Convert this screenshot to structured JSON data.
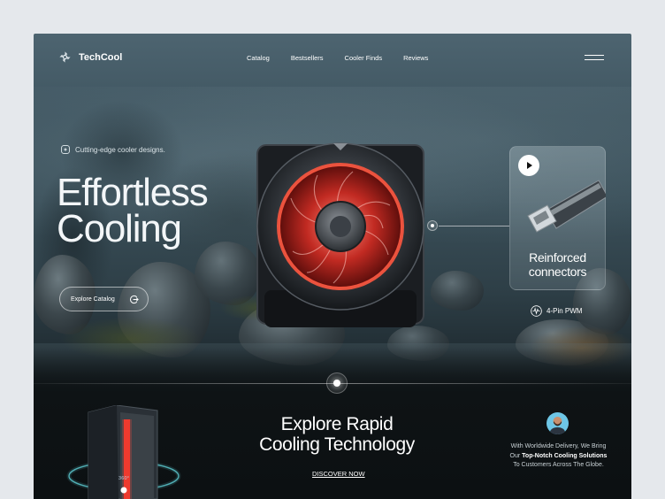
{
  "brand": {
    "name": "TechCool"
  },
  "nav": {
    "items": [
      "Catalog",
      "Bestsellers",
      "Cooler Finds",
      "Reviews"
    ]
  },
  "hero": {
    "tagline": "Cutting-edge cooler designs.",
    "title_line1": "Effortless",
    "title_line2": "Cooling",
    "cta_label": "Explore Catalog"
  },
  "feature_card": {
    "label_line1": "Reinforced",
    "label_line2": "connectors"
  },
  "spec": {
    "label": "4-Pin PWM"
  },
  "case_label": "360°",
  "section": {
    "title_line1": "Explore Rapid",
    "title_line2": "Cooling Technology",
    "link_label": "DISCOVER NOW"
  },
  "delivery": {
    "text1": "With Worldwide Delivery, We Bring Our ",
    "highlight": "Top-Notch Cooling Solutions",
    "text2": " To Customers Across The Globe."
  },
  "colors": {
    "accent_red": "#e8342a",
    "glow_teal": "#5fd0d6"
  }
}
